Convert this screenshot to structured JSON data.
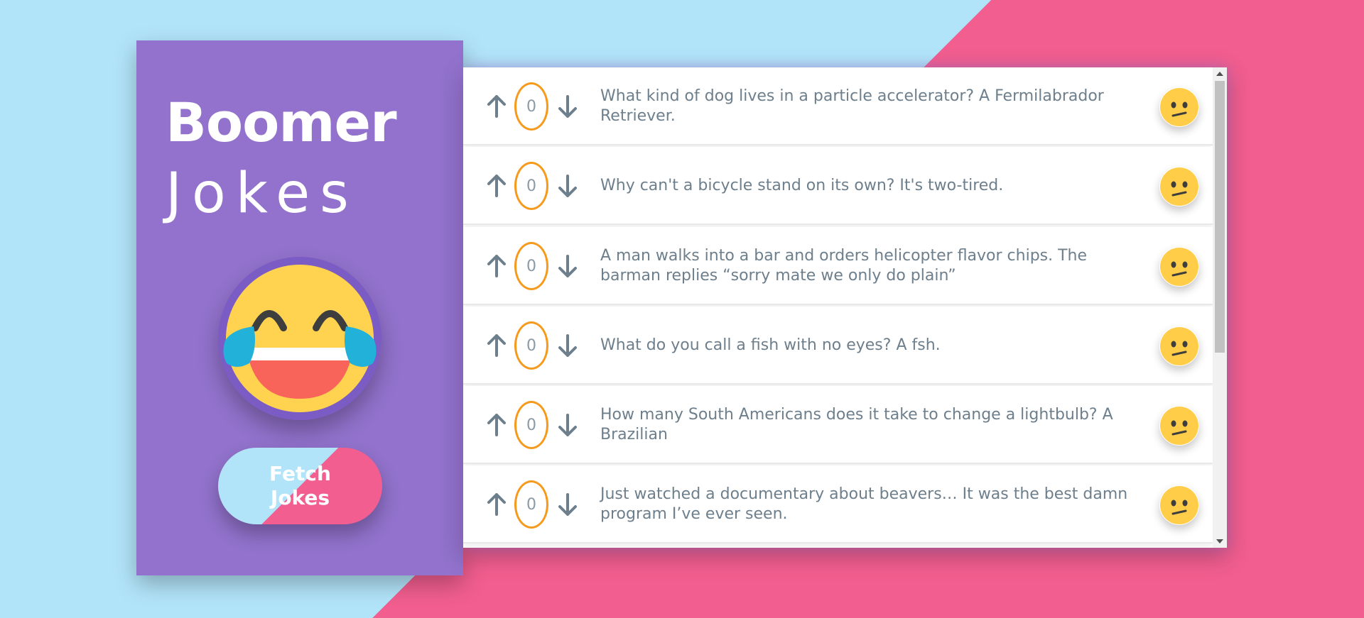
{
  "app": {
    "title_bold": "Boomer",
    "title_light": "Jokes",
    "fetch_button_label": "Fetch Jokes",
    "header_emoji": "face-with-tears-of-joy-icon"
  },
  "colors": {
    "background_left": "#b2e4f9",
    "background_right": "#f15e8f",
    "sidebar": "#9272cc",
    "vote_ring": "#f59a1d",
    "joke_text": "#6d7f8c",
    "emoji_yellow": "#ffd24f"
  },
  "jokes": [
    {
      "votes": "0",
      "text": "What kind of dog lives in a particle accelerator? A Fermilabrador Retriever.",
      "face": "confused-face-icon"
    },
    {
      "votes": "0",
      "text": "Why can't a bicycle stand on its own? It's two-tired.",
      "face": "confused-face-icon"
    },
    {
      "votes": "0",
      "text": "A man walks into a bar and orders helicopter flavor chips. The barman replies “sorry mate we only do plain”",
      "face": "confused-face-icon"
    },
    {
      "votes": "0",
      "text": "What do you call a fish with no eyes? A fsh.",
      "face": "confused-face-icon"
    },
    {
      "votes": "0",
      "text": "How many South Americans does it take to change a lightbulb? A Brazilian",
      "face": "confused-face-icon"
    },
    {
      "votes": "0",
      "text": "Just watched a documentary about beavers… It was the best damn program I’ve ever seen.",
      "face": "confused-face-icon"
    }
  ]
}
